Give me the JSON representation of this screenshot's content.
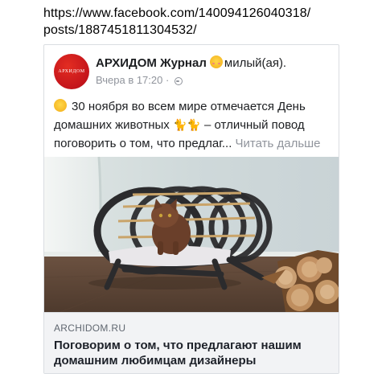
{
  "url": {
    "line1": "https://www.facebook.com/140094126040318/",
    "line2": "posts/1887451811304532/"
  },
  "post": {
    "avatar_text": "АРХИДОМ",
    "page_name": "АРХИДОМ Журнал",
    "feeling": "милый(ая).",
    "time": "Вчера в 17:20",
    "dot": "·",
    "text_main": "30 ноября во всем мире отмечается День домашних животных",
    "text_rest": "– отличный повод поговорить о том, что предлаг...",
    "see_more": "Читать дальше",
    "cat_emoji": "🐈🐈"
  },
  "link": {
    "domain": "ARCHIDOM.RU",
    "title": "Поговорим о том, что предлагают нашим домашним любимцам дизайнеры"
  },
  "colors": {
    "brand_red": "#c4141b",
    "meta_gray": "#90949c",
    "link_bg": "#f2f3f5"
  }
}
